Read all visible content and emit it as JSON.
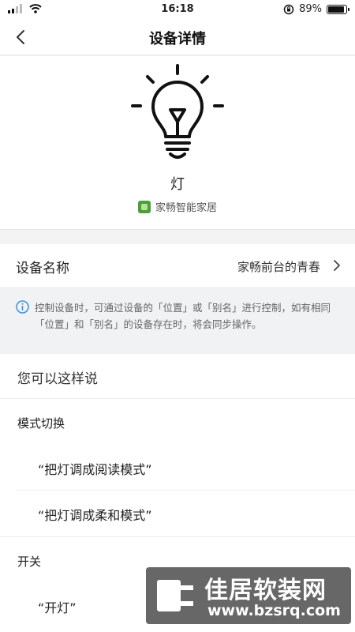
{
  "status_bar": {
    "time": "16:18",
    "battery_percent_text": "89%",
    "battery_level": 0.89
  },
  "nav": {
    "title": "设备详情",
    "back_icon": "chevron-left-icon"
  },
  "device": {
    "icon": "light-bulb-icon",
    "type_name": "灯",
    "brand": "家畅智能家居"
  },
  "name_row": {
    "label": "设备名称",
    "value": "家畅前台的青春"
  },
  "info": {
    "icon": "info-icon",
    "text": "控制设备时，可通过设备的「位置」或「别名」进行控制，如有相同「位置」和「别名」的设备存在时，将会同步操作。"
  },
  "say": {
    "heading": "您可以这样说",
    "groups": [
      {
        "title": "模式切换",
        "phrases": [
          "“把灯调成阅读模式”",
          "“把灯调成柔和模式”"
        ]
      },
      {
        "title": "开关",
        "phrases": [
          "“开灯”"
        ]
      }
    ]
  },
  "watermark": {
    "title": "佳居软装网",
    "url": "www.bzsrq.com"
  },
  "colors": {
    "background": "#f3f3f4",
    "card": "#ffffff",
    "info_accent": "#3a8ee6",
    "brand_green": "#4c9f38"
  }
}
